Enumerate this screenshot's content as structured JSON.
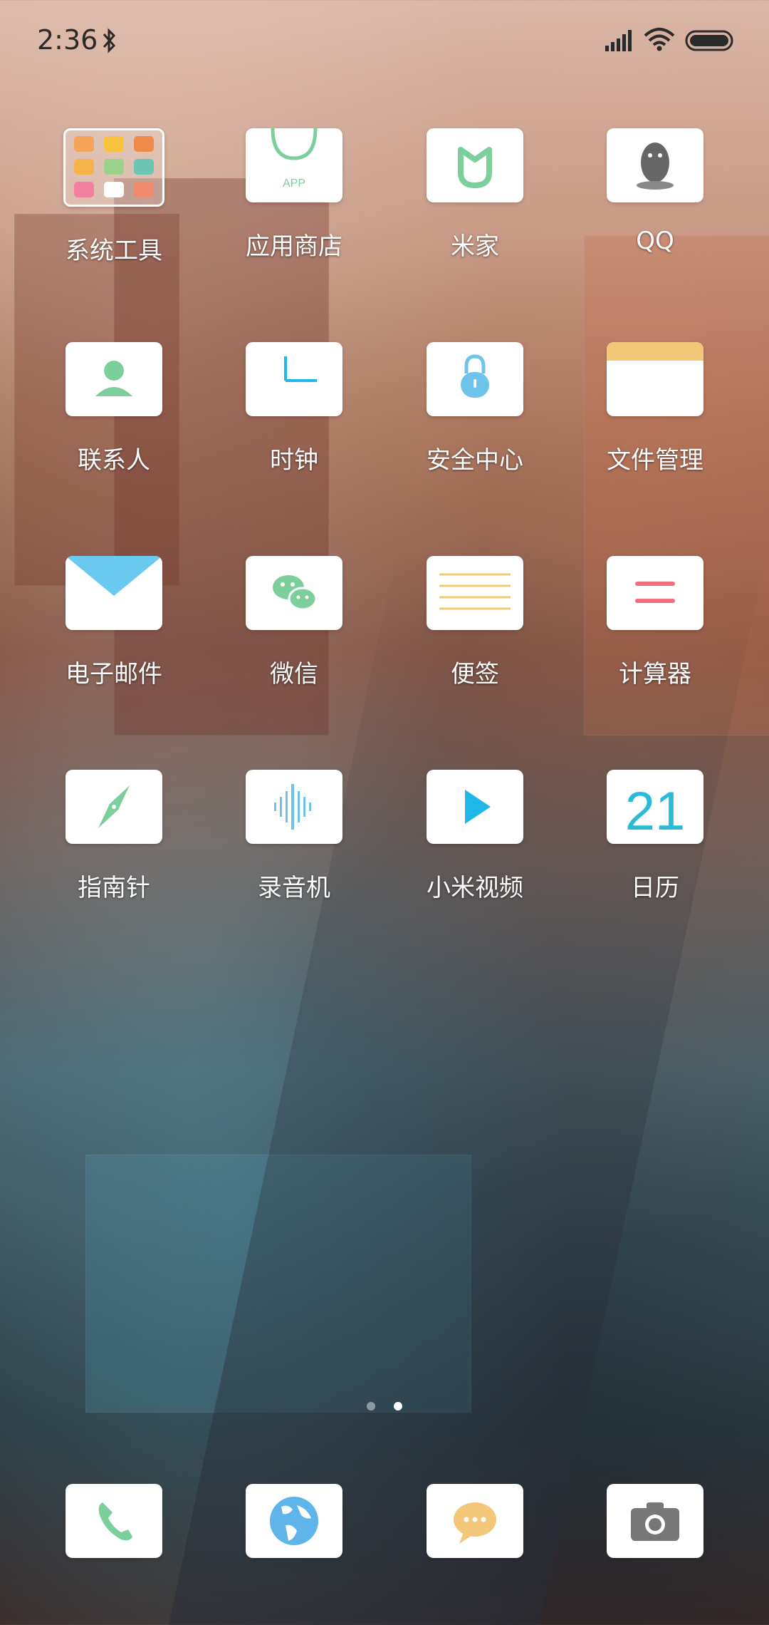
{
  "status_bar": {
    "time": "2:36",
    "bluetooth_icon": "bluetooth-icon",
    "signal_icon": "cellular-signal-icon",
    "wifi_icon": "wifi-icon",
    "battery_icon": "battery-icon"
  },
  "apps": [
    {
      "label": "系统工具",
      "icon": "folder-icon"
    },
    {
      "label": "应用商店",
      "icon": "app-store-icon",
      "tile_text": "APP"
    },
    {
      "label": "米家",
      "icon": "mijia-icon"
    },
    {
      "label": "QQ",
      "icon": "qq-penguin-icon"
    },
    {
      "label": "联系人",
      "icon": "contacts-icon"
    },
    {
      "label": "时钟",
      "icon": "clock-icon"
    },
    {
      "label": "安全中心",
      "icon": "security-lock-icon"
    },
    {
      "label": "文件管理",
      "icon": "file-manager-icon"
    },
    {
      "label": "电子邮件",
      "icon": "email-icon"
    },
    {
      "label": "微信",
      "icon": "wechat-icon"
    },
    {
      "label": "便签",
      "icon": "notes-icon"
    },
    {
      "label": "计算器",
      "icon": "calculator-icon"
    },
    {
      "label": "指南针",
      "icon": "compass-icon"
    },
    {
      "label": "录音机",
      "icon": "recorder-icon"
    },
    {
      "label": "小米视频",
      "icon": "video-play-icon"
    },
    {
      "label": "日历",
      "icon": "calendar-icon",
      "tile_text": "21"
    }
  ],
  "page_indicator": {
    "pages": 2,
    "active": 2
  },
  "dock": [
    {
      "icon": "phone-icon"
    },
    {
      "icon": "browser-globe-icon"
    },
    {
      "icon": "messages-icon"
    },
    {
      "icon": "camera-icon"
    }
  ],
  "colors": {
    "tile_bg": "#ffffff",
    "accent_green": "#7ccf9a",
    "accent_blue": "#1fb7e8",
    "accent_yellow": "#f2c77a",
    "accent_red": "#f06d7f"
  }
}
